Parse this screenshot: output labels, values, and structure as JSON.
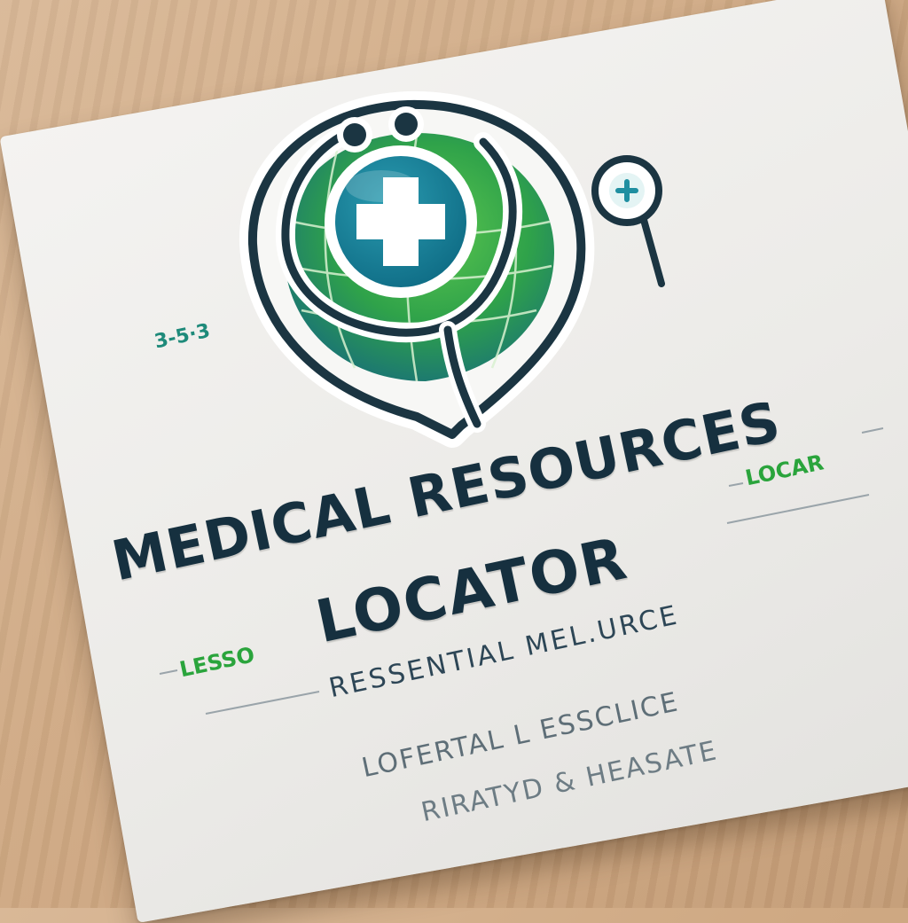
{
  "brand": {
    "title_line1": "MEDICAL RESOURCES",
    "title_line2": "LOCATOR",
    "subtitle": "RESSENTIAL MEL.URCE",
    "tagline_line1": "LOFERTAL L ESSCLICE",
    "tagline_line2": "RIRATYD & HEASATE"
  },
  "decor": {
    "left_mark": "3-5·3",
    "right_mark": "LOCAR",
    "lower_mark": "LESSO"
  },
  "colors": {
    "navy": "#16303f",
    "teal": "#1f7f8c",
    "green": "#38b24a",
    "card": "#efeeeb",
    "wood": "#cfa983"
  },
  "icons": [
    "globe-icon",
    "stethoscope-icon",
    "medical-cross-icon",
    "magnifier-icon"
  ]
}
